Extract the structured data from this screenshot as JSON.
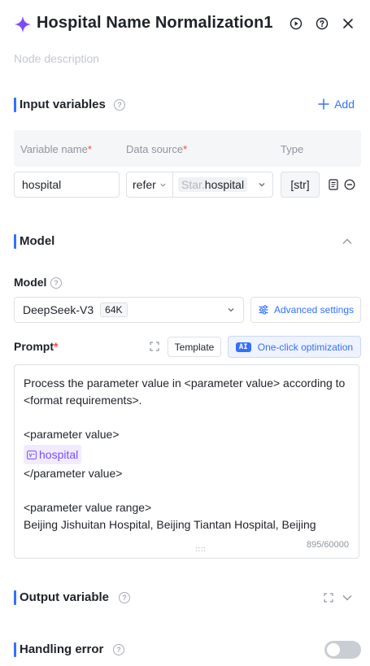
{
  "header": {
    "title": "Hospital Name Normalization1",
    "node_description_placeholder": "Node description"
  },
  "input_variables": {
    "section_title": "Input variables",
    "add_label": "Add",
    "columns": {
      "variable_name": "Variable name",
      "data_source": "Data source",
      "type": "Type",
      "required_mark": "*"
    },
    "rows": [
      {
        "variable_name": "hospital",
        "source_mode": "refer",
        "source_prefix": "Star.",
        "source_value": "hospital",
        "type": "[str]"
      }
    ]
  },
  "model_section": {
    "section_title": "Model",
    "model_label": "Model",
    "model_value": "DeepSeek-V3",
    "context_badge": "64K",
    "advanced_settings_label": "Advanced settings"
  },
  "prompt": {
    "label": "Prompt",
    "required_mark": "*",
    "template_button": "Template",
    "ai_tag": "AI",
    "optimize_button": "One-click optimization",
    "lines": {
      "l1": "Process the parameter value in <parameter value> according to",
      "l2": "<format requirements>.",
      "l3": "<parameter value>",
      "var_chip": "hospital",
      "l4": "</parameter value>",
      "l5": "<parameter value range>",
      "l6": "Beijing Jishuitan Hospital, Beijing Tiantan Hospital, Beijing"
    },
    "counter": "895/60000",
    "resize_grip": "::::"
  },
  "output_variable": {
    "section_title": "Output variable"
  },
  "handling_error": {
    "section_title": "Handling error",
    "enabled": false
  },
  "colors": {
    "accent": "#3370ff",
    "brand_purple": "#7b4cff",
    "required": "#f54a45"
  }
}
